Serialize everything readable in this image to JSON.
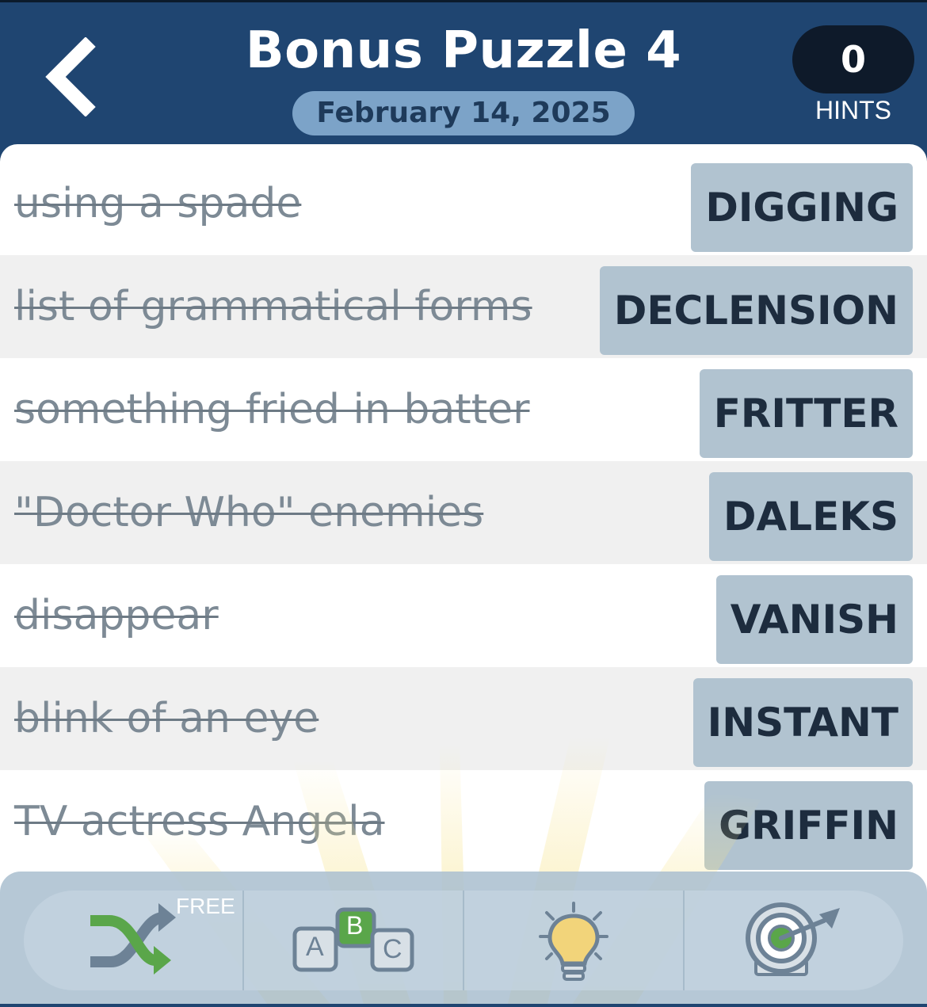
{
  "header": {
    "title": "Bonus Puzzle 4",
    "date": "February 14, 2025",
    "hints_count": "0",
    "hints_label": "HINTS",
    "back_icon": "chevron-left-icon"
  },
  "clues": [
    {
      "clue": "using a spade",
      "answer": "DIGGING"
    },
    {
      "clue": "list of grammatical forms",
      "answer": "DECLENSION"
    },
    {
      "clue": "something fried in batter",
      "answer": "FRITTER"
    },
    {
      "clue": "\"Doctor Who\" enemies",
      "answer": "DALEKS"
    },
    {
      "clue": "disappear",
      "answer": "VANISH"
    },
    {
      "clue": "blink of an eye",
      "answer": "INSTANT"
    },
    {
      "clue": "TV actress Angela",
      "answer": "GRIFFIN"
    }
  ],
  "toolbar": {
    "shuffle_icon": "shuffle-icon",
    "shuffle_badge": "FREE",
    "letters_icon": "abc-blocks-icon",
    "letters_text": [
      "A",
      "B",
      "C"
    ],
    "hint_icon": "lightbulb-icon",
    "solve_icon": "target-dart-icon"
  },
  "colors": {
    "header_bg": "#1f4571",
    "date_pill": "#7ca3c8",
    "answer_tile": "#b1c3d0",
    "answer_text": "#1d2c3e",
    "clue_text": "#7d8a95",
    "row_shade": "#f0f0f0",
    "toolbar_bg": "#acc0d0"
  }
}
